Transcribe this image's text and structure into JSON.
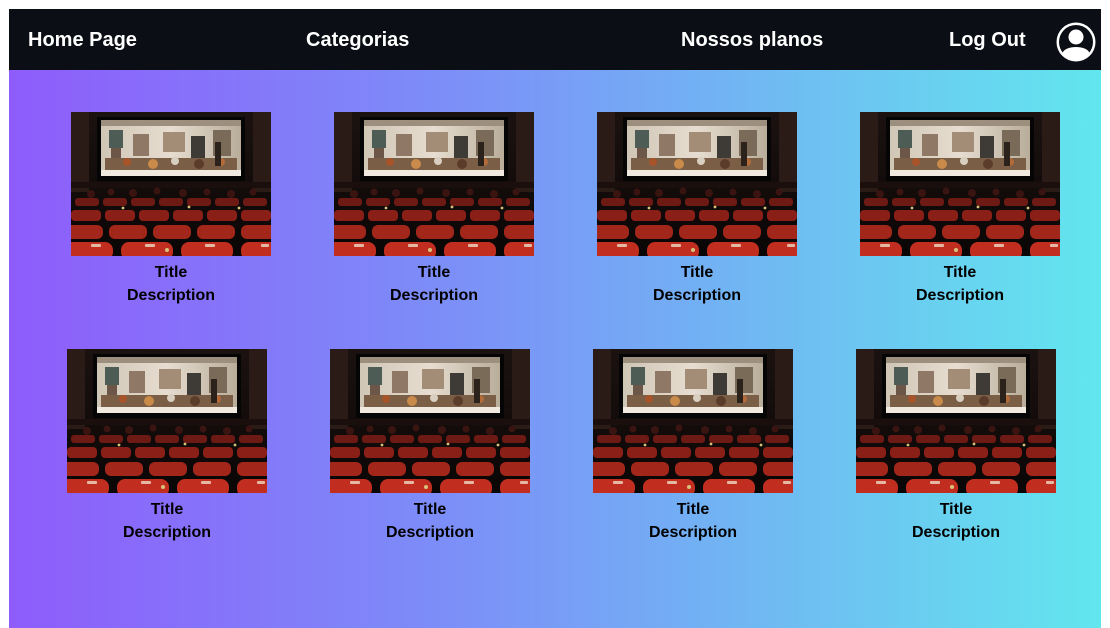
{
  "nav": {
    "home_label": "Home Page",
    "categories_label": "Categorias",
    "plans_label": "Nossos planos",
    "logout_label": "Log Out",
    "avatar_icon": "user-circle-icon"
  },
  "colors": {
    "nav_background": "#0b0e14",
    "gradient_start": "#8e5cfb",
    "gradient_end": "#62e6ee",
    "seat_red": "#b3261e"
  },
  "movie_grid": {
    "thumbnail_icon": "cinema-thumbnail",
    "cards": [
      {
        "title": "Title",
        "description": "Description"
      },
      {
        "title": "Title",
        "description": "Description"
      },
      {
        "title": "Title",
        "description": "Description"
      },
      {
        "title": "Title",
        "description": "Description"
      },
      {
        "title": "Title",
        "description": "Description"
      },
      {
        "title": "Title",
        "description": "Description"
      },
      {
        "title": "Title",
        "description": "Description"
      },
      {
        "title": "Title",
        "description": "Description"
      }
    ]
  }
}
